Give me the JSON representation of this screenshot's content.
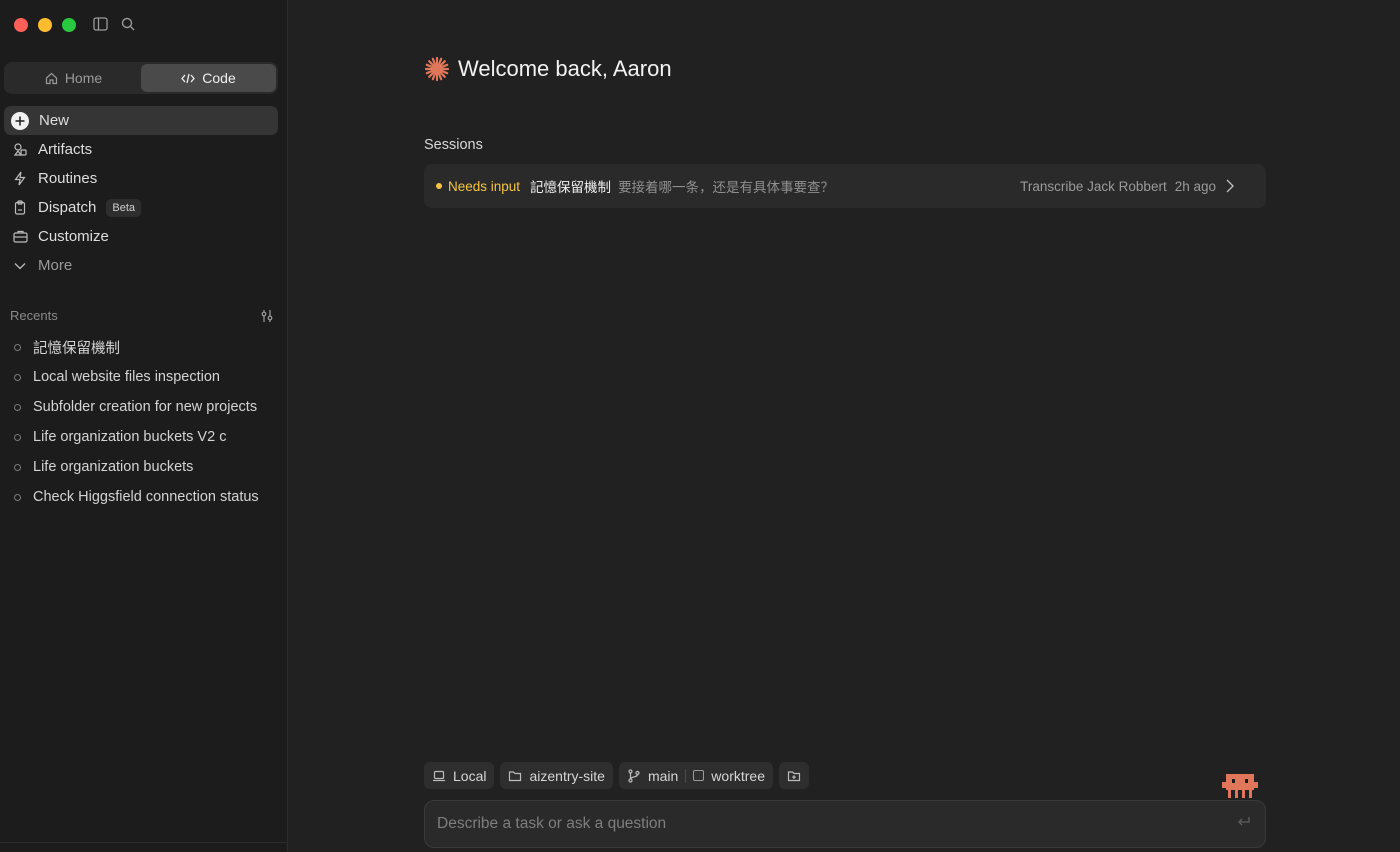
{
  "app": {
    "mode_tabs": [
      {
        "label": "Home",
        "active": false
      },
      {
        "label": "Code",
        "active": true
      }
    ]
  },
  "sidebar": {
    "nav": [
      {
        "label": "New",
        "icon": "plus-icon",
        "active": true
      },
      {
        "label": "Artifacts",
        "icon": "artifacts-icon"
      },
      {
        "label": "Routines",
        "icon": "bolt-icon"
      },
      {
        "label": "Dispatch",
        "icon": "clipboard-icon",
        "badge": "Beta"
      },
      {
        "label": "Customize",
        "icon": "briefcase-icon"
      },
      {
        "label": "More",
        "icon": "chevron-down-icon"
      }
    ],
    "recents_label": "Recents",
    "recents": [
      "記憶保留機制",
      "Local website files inspection",
      "Subfolder creation for new projects",
      "Life organization buckets V2 c",
      "Life organization buckets",
      "Check Higgsfield connection status"
    ]
  },
  "main": {
    "welcome": "Welcome back, Aaron",
    "sessions_label": "Sessions",
    "session": {
      "status": "Needs input",
      "title": "記憶保留機制",
      "message": "要接着哪一条，还是有具体事要查？",
      "project": "Transcribe Jack Robbert",
      "time": "2h ago"
    },
    "chips": {
      "env": "Local",
      "folder": "aizentry-site",
      "branch": "main",
      "worktree": "worktree"
    },
    "input": {
      "placeholder": "Describe a task or ask a question",
      "value": ""
    }
  },
  "colors": {
    "accent": "#e0775a",
    "status_yellow": "#f5c542",
    "bg": "#212121",
    "sidebar_bg": "#1c1c1c"
  }
}
